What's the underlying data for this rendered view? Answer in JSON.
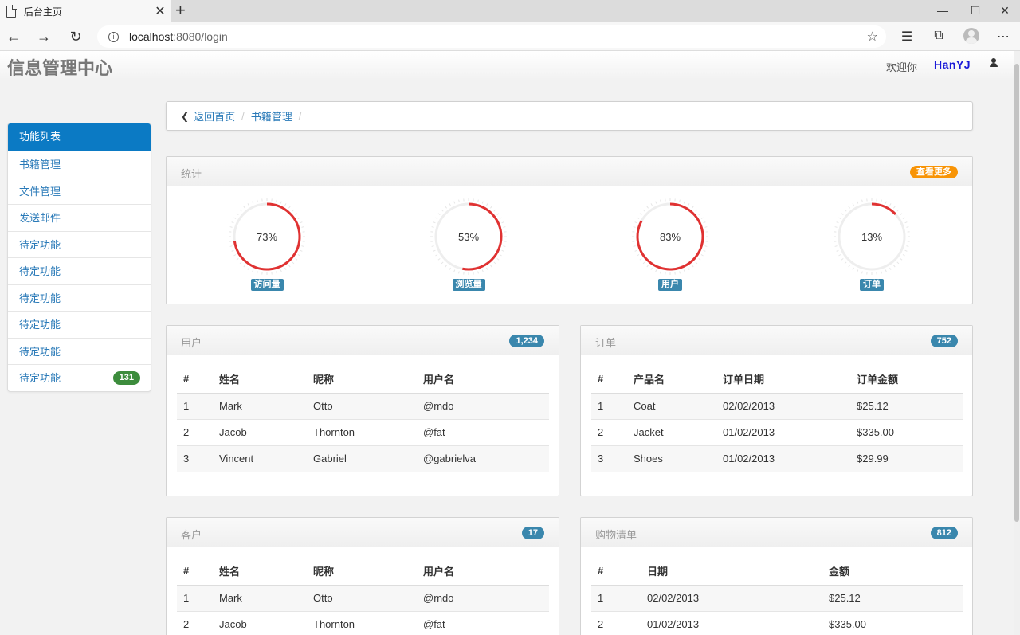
{
  "browser": {
    "tab_title": "后台主页",
    "url_host": "localhost",
    "url_path": ":8080/login"
  },
  "navbar": {
    "brand": "信息管理中心",
    "welcome": "欢迎你",
    "username": "HanYJ"
  },
  "sidebar": {
    "header": "功能列表",
    "items": [
      {
        "label": "书籍管理"
      },
      {
        "label": "文件管理"
      },
      {
        "label": "发送邮件"
      },
      {
        "label": "待定功能"
      },
      {
        "label": "待定功能"
      },
      {
        "label": "待定功能"
      },
      {
        "label": "待定功能"
      },
      {
        "label": "待定功能"
      },
      {
        "label": "待定功能",
        "badge": "131"
      }
    ]
  },
  "breadcrumb": {
    "home": "返回首页",
    "current": "书籍管理",
    "sep": "/"
  },
  "stats": {
    "title": "统计",
    "more": "查看更多",
    "gauges": [
      {
        "label": "访问量",
        "value": 73,
        "text": "73%"
      },
      {
        "label": "浏览量",
        "value": 53,
        "text": "53%"
      },
      {
        "label": "用户",
        "value": 83,
        "text": "83%"
      },
      {
        "label": "订单",
        "value": 13,
        "text": "13%"
      }
    ]
  },
  "users": {
    "title": "用户",
    "badge": "1,234",
    "headers": [
      "#",
      "姓名",
      "昵称",
      "用户名"
    ],
    "rows": [
      [
        "1",
        "Mark",
        "Otto",
        "@mdo"
      ],
      [
        "2",
        "Jacob",
        "Thornton",
        "@fat"
      ],
      [
        "3",
        "Vincent",
        "Gabriel",
        "@gabrielva"
      ]
    ]
  },
  "orders": {
    "title": "订单",
    "badge": "752",
    "headers": [
      "#",
      "产品名",
      "订单日期",
      "订单金额"
    ],
    "rows": [
      [
        "1",
        "Coat",
        "02/02/2013",
        "$25.12"
      ],
      [
        "2",
        "Jacket",
        "01/02/2013",
        "$335.00"
      ],
      [
        "3",
        "Shoes",
        "01/02/2013",
        "$29.99"
      ]
    ]
  },
  "customers": {
    "title": "客户",
    "badge": "17",
    "headers": [
      "#",
      "姓名",
      "昵称",
      "用户名"
    ],
    "rows": [
      [
        "1",
        "Mark",
        "Otto",
        "@mdo"
      ],
      [
        "2",
        "Jacob",
        "Thornton",
        "@fat"
      ]
    ]
  },
  "cart": {
    "title": "购物清单",
    "badge": "812",
    "headers": [
      "#",
      "日期",
      "金额"
    ],
    "rows": [
      [
        "1",
        "02/02/2013",
        "$25.12"
      ],
      [
        "2",
        "01/02/2013",
        "$335.00"
      ]
    ]
  },
  "colors": {
    "gauge_arc": "#e03232",
    "gauge_track": "#eeeeee",
    "accent": "#0b7ac4",
    "badge_blue": "#3a87ad"
  }
}
